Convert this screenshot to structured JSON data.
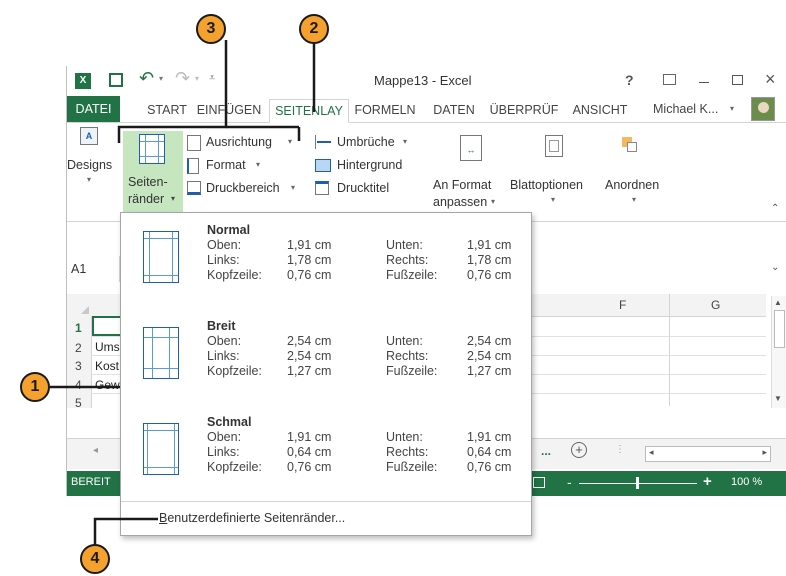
{
  "window": {
    "title": "Mappe13 - Excel",
    "help": "?",
    "user": "Michael K...",
    "colors": {
      "excel_green": "#217346",
      "ribbon_selected": "#c6e6c0",
      "callout": "#f4a22d"
    }
  },
  "tabs": [
    {
      "label": "DATEI"
    },
    {
      "label": "START"
    },
    {
      "label": "EINFÜGEN"
    },
    {
      "label": "SEITENLAY"
    },
    {
      "label": "FORMELN"
    },
    {
      "label": "DATEN"
    },
    {
      "label": "ÜBERPRÜF"
    },
    {
      "label": "ANSICHT"
    }
  ],
  "ribbon": {
    "designs": "Designs",
    "seitenraender_1": "Seiten-",
    "seitenraender_2": "ränder",
    "ausrichtung": "Ausrichtung",
    "format": "Format",
    "druckbereich": "Druckbereich",
    "umbrueche": "Umbrüche",
    "hintergrund": "Hintergrund",
    "drucktitel": "Drucktitel",
    "an_format_1": "An Format",
    "an_format_2": "anpassen",
    "blattoptionen": "Blattoptionen",
    "anordnen": "Anordnen"
  },
  "formula_bar": {
    "name_box": "A1"
  },
  "sheet": {
    "columns": [
      "F",
      "G"
    ],
    "rows": [
      {
        "num": "1",
        "a": ""
      },
      {
        "num": "2",
        "a": "Ums"
      },
      {
        "num": "3",
        "a": "Kost"
      },
      {
        "num": "4",
        "a": "Gew"
      },
      {
        "num": "5",
        "a": ""
      }
    ],
    "dots": "..."
  },
  "status": {
    "ready": "BEREIT",
    "zoom": "100 %"
  },
  "margins_menu": {
    "presets": [
      {
        "name": "Normal",
        "top_label": "Oben:",
        "top": "1,91 cm",
        "bottom_label": "Unten:",
        "bottom": "1,91 cm",
        "left_label": "Links:",
        "left": "1,78 cm",
        "right_label": "Rechts:",
        "right": "1,78 cm",
        "header_label": "Kopfzeile:",
        "header": "0,76 cm",
        "footer_label": "Fußzeile:",
        "footer": "0,76 cm"
      },
      {
        "name": "Breit",
        "top_label": "Oben:",
        "top": "2,54 cm",
        "bottom_label": "Unten:",
        "bottom": "2,54 cm",
        "left_label": "Links:",
        "left": "2,54 cm",
        "right_label": "Rechts:",
        "right": "2,54 cm",
        "header_label": "Kopfzeile:",
        "header": "1,27 cm",
        "footer_label": "Fußzeile:",
        "footer": "1,27 cm"
      },
      {
        "name": "Schmal",
        "top_label": "Oben:",
        "top": "1,91 cm",
        "bottom_label": "Unten:",
        "bottom": "1,91 cm",
        "left_label": "Links:",
        "left": "0,64 cm",
        "right_label": "Rechts:",
        "right": "0,64 cm",
        "header_label": "Kopfzeile:",
        "header": "0,76 cm",
        "footer_label": "Fußzeile:",
        "footer": "0,76 cm"
      }
    ],
    "custom_prefix": "B",
    "custom_rest": "enutzerdefinierte Seitenränder..."
  },
  "callouts": [
    "1",
    "2",
    "3",
    "4"
  ]
}
